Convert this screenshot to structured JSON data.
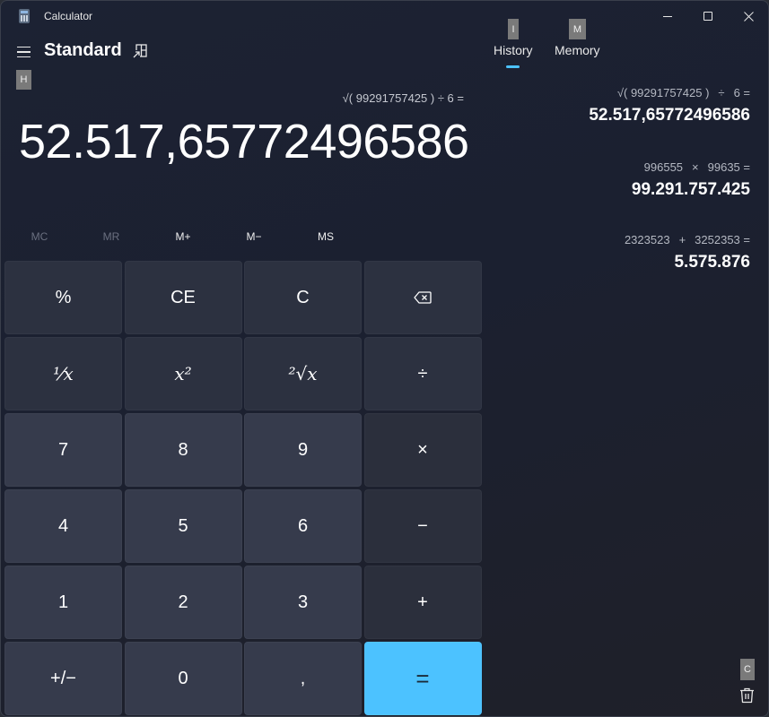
{
  "window": {
    "title": "Calculator",
    "icons": {
      "app": "calculator-app-icon",
      "minimize": "minimize-icon",
      "maximize": "maximize-icon",
      "close": "close-icon"
    }
  },
  "header": {
    "menu_icon": "hamburger-menu-icon",
    "mode_title": "Standard",
    "keep_on_top_icon": "keep-on-top-icon"
  },
  "access_keys": {
    "header": "H",
    "history": "I",
    "memory": "M",
    "clear_history": "C"
  },
  "tabs": [
    {
      "label": "History",
      "active": true
    },
    {
      "label": "Memory",
      "active": false
    }
  ],
  "accent_color": "#4cc2ff",
  "display": {
    "expression": "√( 99291757425 ) ÷ 6 =",
    "result": "52.517,65772496586"
  },
  "memory_buttons": [
    {
      "label": "MC",
      "enabled": false
    },
    {
      "label": "MR",
      "enabled": false
    },
    {
      "label": "M+",
      "enabled": true
    },
    {
      "label": "M−",
      "enabled": true
    },
    {
      "label": "MS",
      "enabled": true
    }
  ],
  "keys": [
    {
      "label": "%",
      "name": "percent"
    },
    {
      "label": "CE",
      "name": "clear-entry"
    },
    {
      "label": "C",
      "name": "clear"
    },
    {
      "label": "⌫",
      "name": "backspace"
    },
    {
      "label": "¹⁄x",
      "name": "reciprocal"
    },
    {
      "label": "x²",
      "name": "square"
    },
    {
      "label": "²√x",
      "name": "square-root"
    },
    {
      "label": "÷",
      "name": "divide"
    },
    {
      "label": "7",
      "name": "seven"
    },
    {
      "label": "8",
      "name": "eight"
    },
    {
      "label": "9",
      "name": "nine"
    },
    {
      "label": "×",
      "name": "multiply"
    },
    {
      "label": "4",
      "name": "four"
    },
    {
      "label": "5",
      "name": "five"
    },
    {
      "label": "6",
      "name": "six"
    },
    {
      "label": "−",
      "name": "subtract"
    },
    {
      "label": "1",
      "name": "one"
    },
    {
      "label": "2",
      "name": "two"
    },
    {
      "label": "3",
      "name": "three"
    },
    {
      "label": "+",
      "name": "add"
    },
    {
      "label": "+/−",
      "name": "negate"
    },
    {
      "label": "0",
      "name": "zero"
    },
    {
      "label": ",",
      "name": "decimal"
    },
    {
      "label": "=",
      "name": "equals"
    }
  ],
  "history": [
    {
      "operand1": "√( 99291757425 )",
      "operator": "÷",
      "operand2": "6 =",
      "result": "52.517,65772496586"
    },
    {
      "operand1": "996555",
      "operator": "×",
      "operand2": "99635 =",
      "result": "99.291.757.425"
    },
    {
      "operand1": "2323523",
      "operator": "+",
      "operand2": "3252353 =",
      "result": "5.575.876"
    }
  ],
  "clear_history_icon": "trash-icon"
}
